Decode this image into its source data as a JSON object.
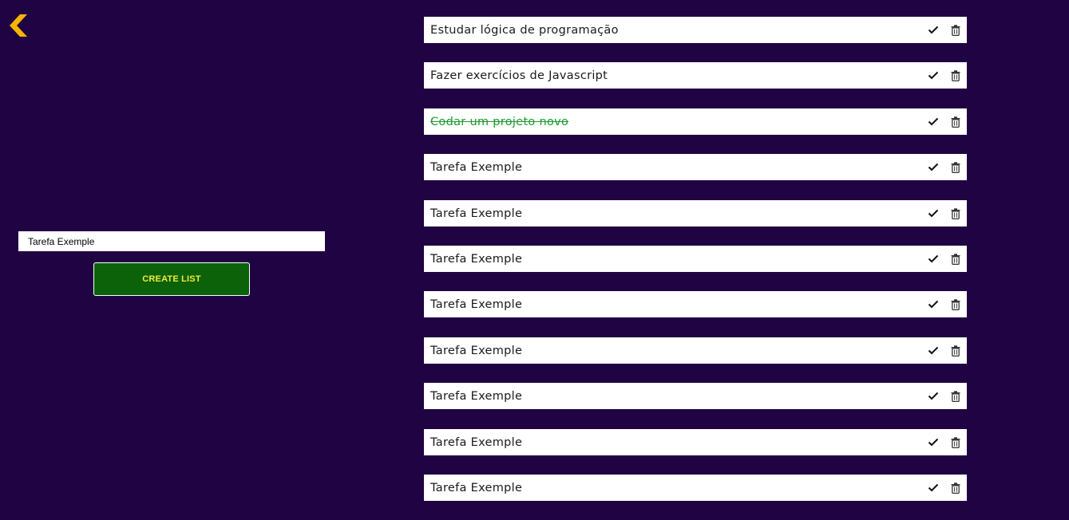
{
  "colors": {
    "background": "#200342",
    "back_icon": "#f7b500",
    "button_bg": "#0b6209",
    "button_text": "#f3e93b",
    "done_text": "#1e9b2e"
  },
  "nav": {
    "back_icon": "chevron-left-icon"
  },
  "form": {
    "input_value": "Tarefa Exemple",
    "create_label": "CREATE LIST"
  },
  "tasks": [
    {
      "text": "Estudar lógica de programação",
      "done": false
    },
    {
      "text": "Fazer exercícios de Javascript",
      "done": false
    },
    {
      "text": "Codar um projeto novo",
      "done": true
    },
    {
      "text": "Tarefa Exemple",
      "done": false
    },
    {
      "text": "Tarefa Exemple",
      "done": false
    },
    {
      "text": "Tarefa Exemple",
      "done": false
    },
    {
      "text": "Tarefa Exemple",
      "done": false
    },
    {
      "text": "Tarefa Exemple",
      "done": false
    },
    {
      "text": "Tarefa Exemple",
      "done": false
    },
    {
      "text": "Tarefa Exemple",
      "done": false
    },
    {
      "text": "Tarefa Exemple",
      "done": false
    }
  ],
  "task_icons": {
    "complete": "check-icon",
    "delete": "trash-icon"
  }
}
